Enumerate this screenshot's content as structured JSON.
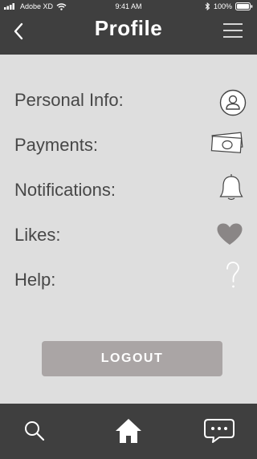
{
  "status_bar": {
    "carrier": "Adobe XD",
    "time": "9:41 AM",
    "battery": "100%"
  },
  "header": {
    "title": "Profile",
    "back_icon": "chevron-left-icon",
    "menu_icon": "hamburger-menu-icon"
  },
  "menu": {
    "items": [
      {
        "label": "Personal Info:",
        "icon": "user-circle-icon"
      },
      {
        "label": "Payments:",
        "icon": "cash-icon"
      },
      {
        "label": "Notifications:",
        "icon": "bell-icon"
      },
      {
        "label": "Likes:",
        "icon": "heart-icon"
      },
      {
        "label": "Help:",
        "icon": "question-icon"
      }
    ]
  },
  "logout": {
    "label": "LOGOUT"
  },
  "tab_bar": {
    "tabs": [
      {
        "icon": "search-icon"
      },
      {
        "icon": "home-icon"
      },
      {
        "icon": "chat-icon"
      }
    ]
  },
  "colors": {
    "bar_background": "#3f3f3f",
    "page_background": "#dedede",
    "text": "#474747",
    "logout_button": "#aaa5a5"
  }
}
